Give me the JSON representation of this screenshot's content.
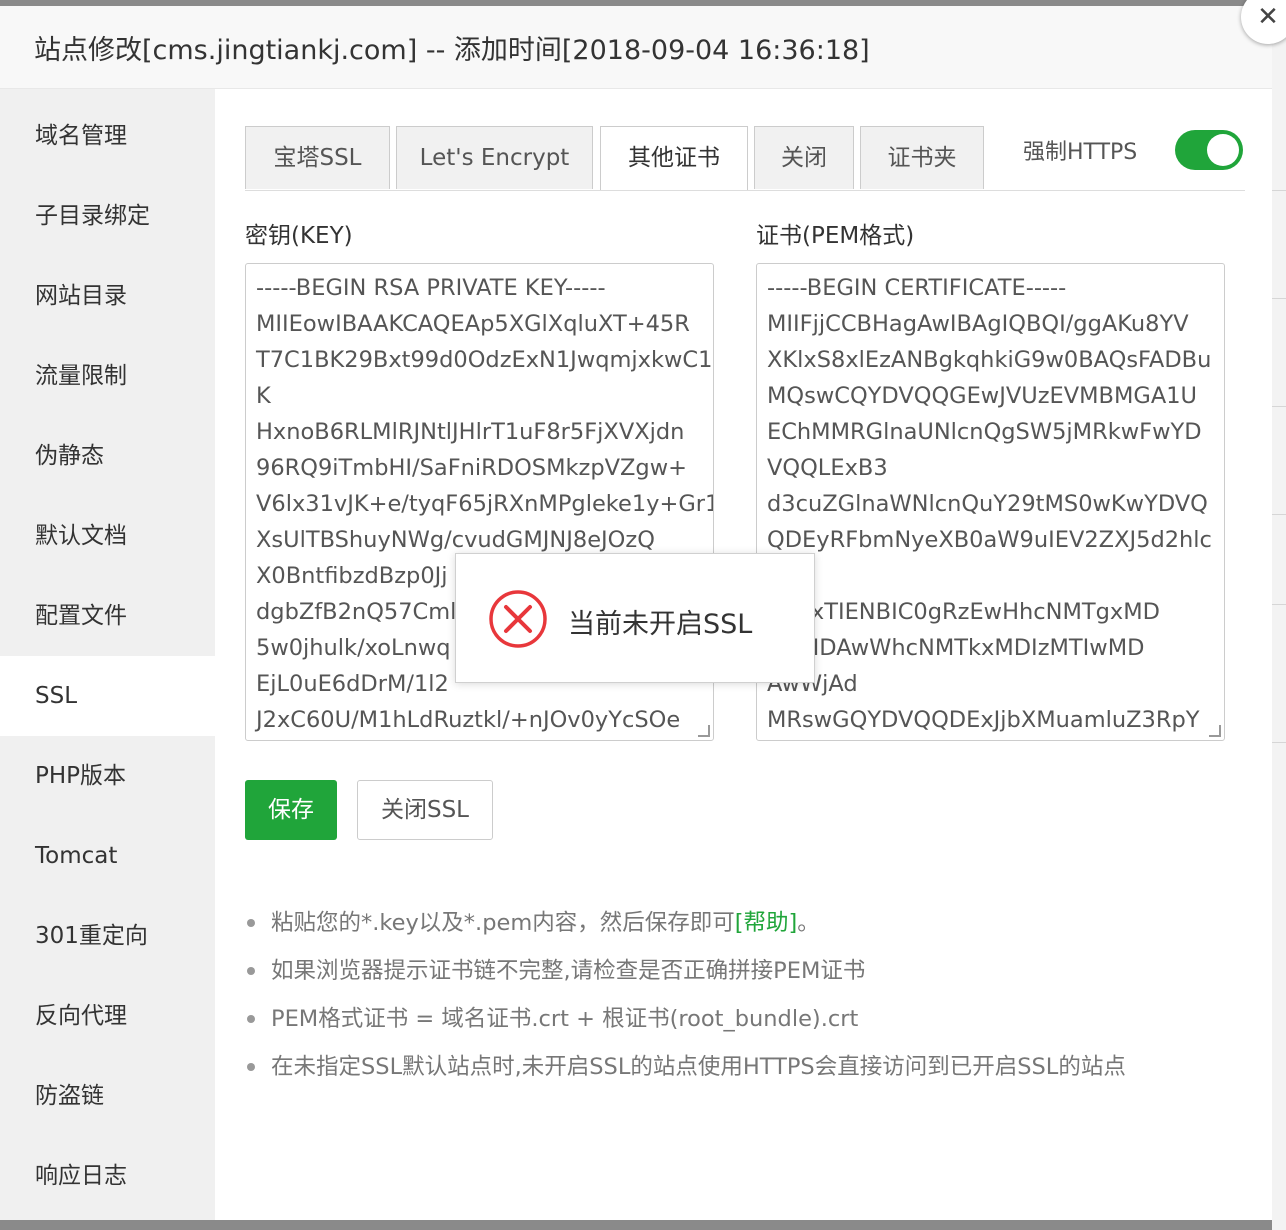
{
  "dialog": {
    "title": "站点修改[cms.jingtiankj.com] -- 添加时间[2018-09-04 16:36:18]",
    "close_icon": "close-icon"
  },
  "sidebar": {
    "items": [
      {
        "label": "域名管理"
      },
      {
        "label": "子目录绑定"
      },
      {
        "label": "网站目录"
      },
      {
        "label": "流量限制"
      },
      {
        "label": "伪静态"
      },
      {
        "label": "默认文档"
      },
      {
        "label": "配置文件"
      },
      {
        "label": "SSL",
        "active": true
      },
      {
        "label": "PHP版本"
      },
      {
        "label": "Tomcat"
      },
      {
        "label": "301重定向"
      },
      {
        "label": "反向代理"
      },
      {
        "label": "防盗链"
      },
      {
        "label": "响应日志"
      }
    ]
  },
  "tabs": [
    {
      "label": "宝塔SSL"
    },
    {
      "label": "Let's Encrypt"
    },
    {
      "label": "其他证书",
      "active": true
    },
    {
      "label": "关闭"
    },
    {
      "label": "证书夹"
    }
  ],
  "force_https": {
    "label": "强制HTTPS",
    "enabled": true
  },
  "key_field": {
    "label": "密钥(KEY)",
    "value": "-----BEGIN RSA PRIVATE KEY-----\nMIIEowIBAAKCAQEAp5XGlXqluXT+45R\nT7C1BK29Bxt99d0OdzExN1JwqmjxkwC1\nK\nHxnoB6RLMlRJNtlJHlrT1uF8r5FjXVXjdn\n96RQ9iTmbHI/SaFniRDOSMkzpVZgw+\nV6lx31vJK+e/tyqF65jRXnMPgleke1y+Gr1\nXsUlTBShuyNWg/cvudGMJNJ8eJOzQ\nX0BntfibzdBzp0Jj\ndgbZfB2nQ57Cml\n5w0jhulk/xoLnwq\nEjL0uE6dDrM/1l2\nJ2xC60U/M1hLdRuztkl/+nJOv0yYcSOe"
  },
  "cert_field": {
    "label": "证书(PEM格式)",
    "value": "-----BEGIN CERTIFICATE-----\nMIIFjjCCBHagAwIBAgIQBQI/ggAKu8YV\nXKlxS8xlEzANBgkqhkiG9w0BAQsFADBu\nMQswCQYDVQQGEwJVUzEVMBMGA1U\nEChMMRGlnaUNlcnQgSW5jMRkwFwYD\nVQQLExB3\nd3cuZGlnaWNlcnQuY29tMS0wKwYDVQ\nQDEyRFbmNyeXB0aW9uIEV2ZXJ5d2hlc\n\ngVExTIENBIC0gRzEwHhcNMTgxMD\nAwMDAwWhcNMTkxMDIzMTIwMD\nAwWjAd\nMRswGQYDVQQDExJjbXMuamluZ3RpY"
  },
  "buttons": {
    "save": "保存",
    "close_ssl": "关闭SSL"
  },
  "tips": {
    "tip1_text": "粘贴您的*.key以及*.pem内容，然后保存即可",
    "tip1_link": "[帮助]",
    "tip1_end": "。",
    "tip2": "如果浏览器提示证书链不完整,请检查是否正确拼接PEM证书",
    "tip3": "PEM格式证书 = 域名证书.crt + 根证书(root_bundle).crt",
    "tip4": "在未指定SSL默认站点时,未开启SSL的站点使用HTTPS会直接访问到已开启SSL的站点"
  },
  "toast": {
    "message": "当前未开启SSL",
    "icon": "error-icon",
    "icon_color": "#e8373b"
  },
  "colors": {
    "accent": "#20a53a",
    "sidebar_bg": "#f0f0f0"
  }
}
